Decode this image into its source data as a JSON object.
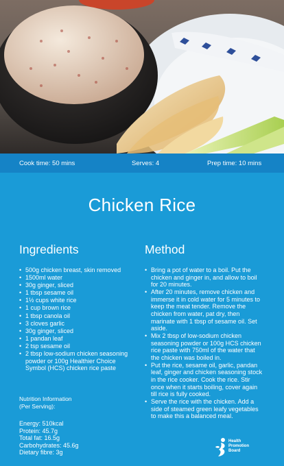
{
  "header_photo": {
    "description_icon": "chicken-rice-photo"
  },
  "info_strip": {
    "cook_time": "Cook time: 50 mins",
    "serves": "Serves: 4",
    "prep_time": "Prep time: 10 mins"
  },
  "title": "Chicken Rice",
  "ingredients": {
    "heading": "Ingredients",
    "items": [
      "500g chicken breast, skin removed",
      "1500ml water",
      "30g ginger, sliced",
      "1 tbsp sesame oil",
      "1½ cups white rice",
      "1 cup brown rice",
      "1 tbsp canola oil",
      "3 cloves garlic",
      "30g ginger, sliced",
      "1 pandan leaf",
      "2 tsp sesame oil",
      "2 tbsp low-sodium chicken seasoning powder or 100g Healthier Choice Symbol (HCS) chicken rice paste"
    ]
  },
  "nutrition": {
    "heading": "Nutrition Information",
    "subheading": "(Per Serving):",
    "facts": [
      "Energy: 510kcal",
      "Protein: 45.7g",
      "Total fat: 16.5g",
      "Carbohydrates: 45.6g",
      "Dietary fibre: 3g"
    ]
  },
  "method": {
    "heading": "Method",
    "steps": [
      "Bring a pot of water to a boil. Put the chicken and ginger in, and allow to boil for 20 minutes.",
      "After 20 minutes, remove chicken and immerse it in cold water for 5 minutes to keep the meat tender. Remove the chicken from water, pat dry, then marinate with 1 tbsp of sesame oil. Set aside.",
      "Mix 2 tbsp of low-sodium chicken seasoning powder or 100g HCS chicken rice paste with 750ml of the water that the chicken was boiled in.",
      "Put the rice, sesame oil, garlic, pandan leaf, ginger and chicken seasoning stock in the rice cooker. Cook the rice. Stir once when it starts boiling, cover again till rice is fully cooked.",
      "Serve the rice with the chicken. Add a side of steamed green leafy vegetables to make this a balanced meal."
    ]
  },
  "logo": {
    "line1": "Health",
    "line2": "Promotion",
    "line3": "Board"
  },
  "colors": {
    "background": "#1a9bd7",
    "strip": "#1583c6",
    "text": "#ffffff"
  }
}
